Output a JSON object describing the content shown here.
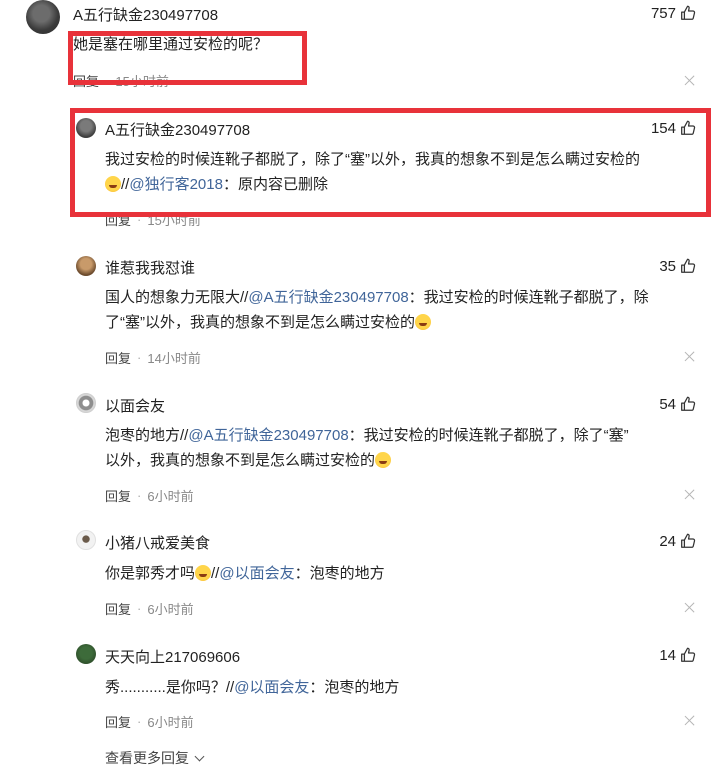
{
  "comments": [
    {
      "username": "A五行缺金230497708",
      "likes": "757",
      "text": "她是塞在哪里通过安检的呢？",
      "reply_label": "回复",
      "time": "15小时前"
    },
    {
      "username": "A五行缺金230497708",
      "likes": "154",
      "text_line1": "我过安检的时候连靴子都脱了，除了“塞”以外，我真的想象不到是怎么瞒过安检的",
      "text_line2_sep": "//",
      "text_line2_mention": "@独行客2018",
      "text_line2_rest": "：原内容已删除",
      "reply_label": "回复",
      "time": "15小时前"
    },
    {
      "username": "谁惹我我怼谁",
      "likes": "35",
      "text_line1_a": "国人的想象力无限大//",
      "text_line1_mention": "@A五行缺金230497708",
      "text_line1_b": "：我过安检的时候连靴子都脱了，除",
      "text_line2": "了“塞”以外，我真的想象不到是怎么瞒过安检的",
      "reply_label": "回复",
      "time": "14小时前"
    },
    {
      "username": "以面会友",
      "likes": "54",
      "text_line1_a": "泡枣的地方//",
      "text_line1_mention": "@A五行缺金230497708",
      "text_line1_b": "：我过安检的时候连靴子都脱了，除了“塞”",
      "text_line2": "以外，我真的想象不到是怎么瞒过安检的",
      "reply_label": "回复",
      "time": "6小时前"
    },
    {
      "username": "小猪八戒爱美食",
      "likes": "24",
      "text_a": "你是郭秀才吗",
      "text_sep": "//",
      "text_mention": "@以面会友",
      "text_b": "：泡枣的地方",
      "reply_label": "回复",
      "time": "6小时前"
    },
    {
      "username": "天天向上217069606",
      "likes": "14",
      "text_a": "秀...........是你吗？//",
      "text_mention": "@以面会友",
      "text_b": "：泡枣的地方",
      "reply_label": "回复",
      "time": "6小时前"
    }
  ],
  "more_replies_label": "查看更多回复",
  "colors": {
    "mention": "#406599",
    "highlight": "#e8323a"
  }
}
